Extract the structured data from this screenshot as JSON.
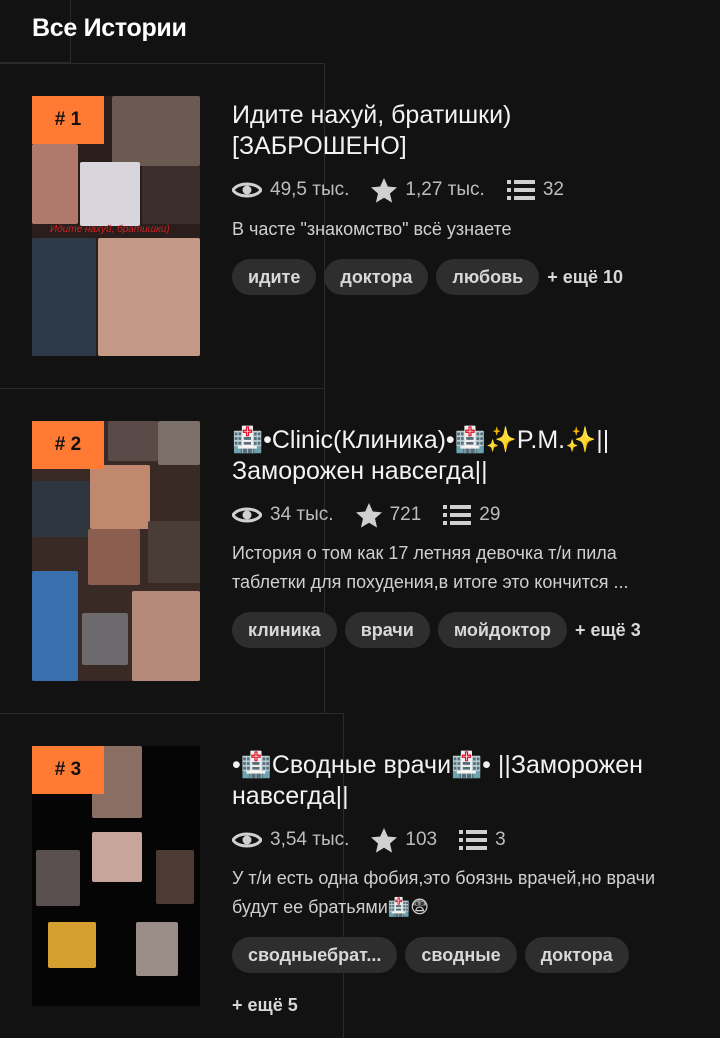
{
  "header": {
    "title": "Все Истории"
  },
  "stories": [
    {
      "rank": "# 1",
      "title": "Идите нахуй, братишки) [ЗАБРОШЕНО]",
      "views": "49,5 тыс.",
      "votes": "1,27 тыс.",
      "parts": "32",
      "description": "В часте \"знакомство\" всё узнаете",
      "tags": [
        "идите",
        "доктора",
        "любовь"
      ],
      "more_tags": "+ ещё 10",
      "cover_caption": "Идите нахуй, братишки)"
    },
    {
      "rank": "# 2",
      "title": "🏥•Clinic(Клиника)•🏥✨P.M.✨|| Заморожен навсегда||",
      "views": "34 тыс.",
      "votes": "721",
      "parts": "29",
      "description": "История о том как 17 летняя девочка т/и пила таблетки для похудения,в итоге это кончится ...",
      "tags": [
        "клиника",
        "врачи",
        "мойдоктор"
      ],
      "more_tags": "+ ещё 3"
    },
    {
      "rank": "# 3",
      "title": "•🏥Сводные врачи🏥• ||Заморожен навсегда||",
      "views": "3,54 тыс.",
      "votes": "103",
      "parts": "3",
      "description": "У т/и есть одна фобия,это боязнь врачей,но врачи будут ее братьями🏥😨",
      "tags": [
        "сводныебрат...",
        "сводные",
        "доктора"
      ],
      "more_tags": "+ ещё 5"
    }
  ],
  "colors": {
    "background": "#121212",
    "accent": "#ff7a33",
    "tag_bg": "#2e2e2e"
  },
  "icons": [
    "eye-icon",
    "star-icon",
    "list-icon"
  ]
}
